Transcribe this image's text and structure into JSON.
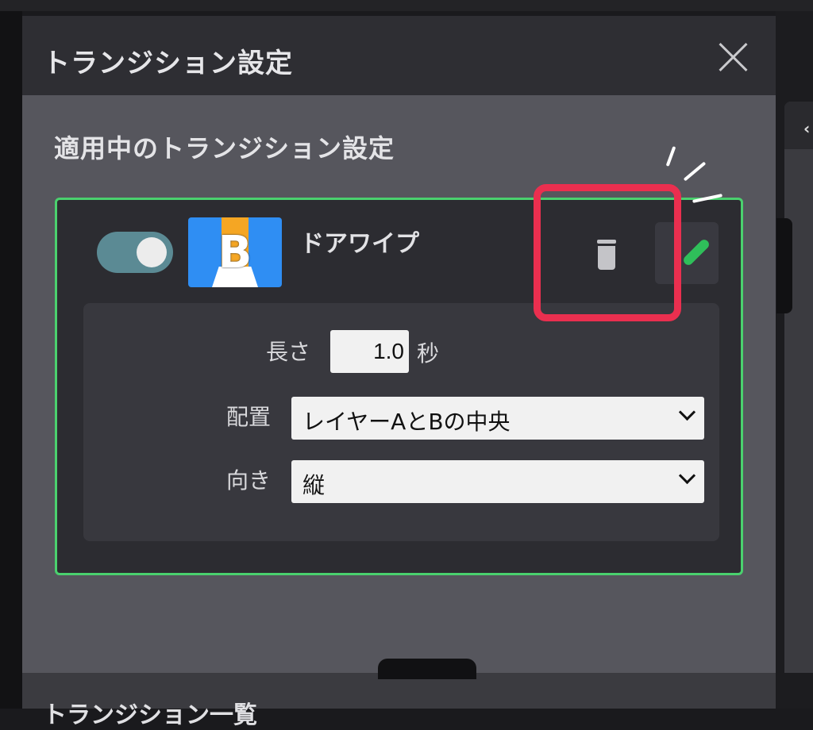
{
  "dialog": {
    "title": "トランジション設定"
  },
  "applied_section": {
    "title": "適用中のトランジション設定"
  },
  "transition": {
    "enabled": true,
    "thumbnail_letter": "B",
    "name": "ドアワイプ",
    "length_label": "長さ",
    "length_value": "1.0",
    "length_unit": "秒",
    "placement_label": "配置",
    "placement_value": "レイヤーAとBの中央",
    "direction_label": "向き",
    "direction_value": "縦"
  },
  "next_section": {
    "title": "トランジション一覧"
  },
  "colors": {
    "panel_bg": "#56565d",
    "card_border": "#4ad16e",
    "highlight": "#ea2f4f",
    "toggle": "#5b8a94",
    "edit_icon": "#2fbf5a"
  },
  "icons": [
    "close-icon",
    "trash-icon",
    "pencil-icon",
    "chevron-down-icon",
    "chevron-left-icon"
  ]
}
